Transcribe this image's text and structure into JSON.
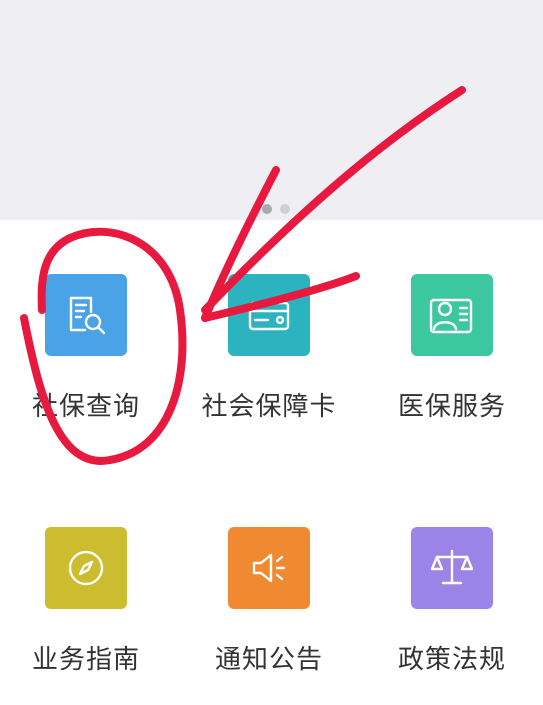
{
  "colors": {
    "banner_bg": "#efeef2",
    "annotation_red": "#e8193f"
  },
  "carousel": {
    "page_count": 2,
    "active_index": 0
  },
  "grid": {
    "items": [
      {
        "label": "社保查询",
        "icon": "document-search-icon",
        "color": "#4aa3e6"
      },
      {
        "label": "社会保障卡",
        "icon": "card-icon",
        "color": "#2bb3c0"
      },
      {
        "label": "医保服务",
        "icon": "person-card-icon",
        "color": "#3cc7a0"
      },
      {
        "label": "业务指南",
        "icon": "compass-icon",
        "color": "#cbbd2f"
      },
      {
        "label": "通知公告",
        "icon": "speaker-icon",
        "color": "#f08a32"
      },
      {
        "label": "政策法规",
        "icon": "scales-icon",
        "color": "#9b83e8"
      }
    ]
  }
}
